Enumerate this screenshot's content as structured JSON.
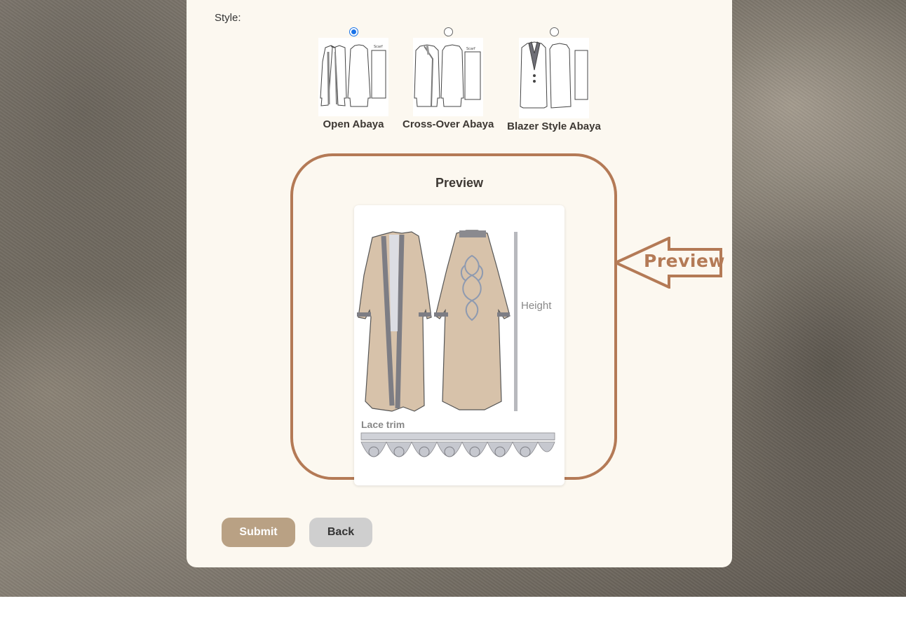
{
  "form": {
    "style_label": "Style:",
    "options": [
      {
        "label": "Open Abaya",
        "selected": true,
        "thumb_icon": "open-abaya-sketch"
      },
      {
        "label": "Cross-Over Abaya",
        "selected": false,
        "thumb_icon": "cross-over-abaya-sketch"
      },
      {
        "label": "Blazer Style Abaya",
        "selected": false,
        "thumb_icon": "blazer-abaya-sketch"
      }
    ],
    "thumb_scarf_text": "Scarf"
  },
  "preview": {
    "title": "Preview",
    "height_label": "Height",
    "lace_label": "Lace trim",
    "annotation": "Preview"
  },
  "buttons": {
    "submit": "Submit",
    "back": "Back"
  },
  "colors": {
    "accent": "#b47a56",
    "submit_bg": "#b9a184",
    "back_bg": "#cfcfcf",
    "card_bg": "#fcf8f0",
    "fabric": "#d7c2aa",
    "trim": "#8a8a8f",
    "radio_selected": "#1a73e8"
  }
}
